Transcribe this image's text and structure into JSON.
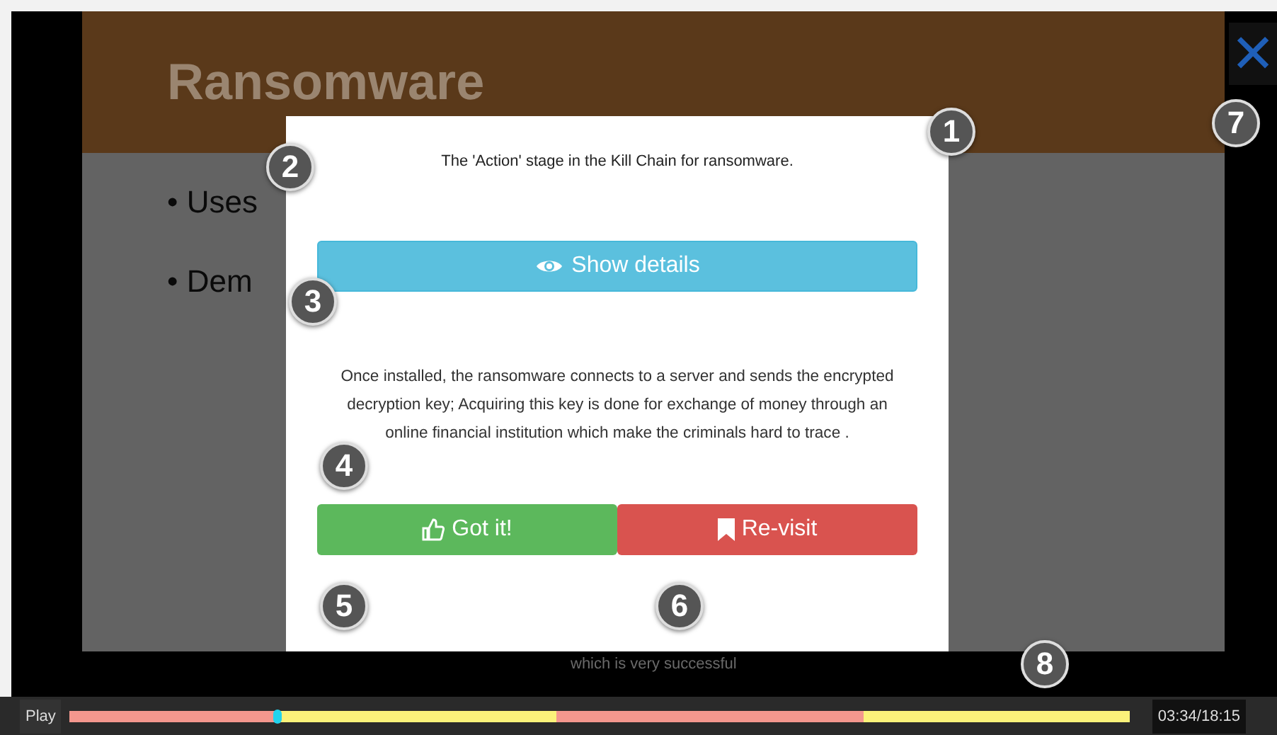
{
  "slide": {
    "title": "Ransomware",
    "bullets": [
      "• Uses",
      "• Dem"
    ],
    "caption": "which is very successful"
  },
  "modal": {
    "prompt": "The 'Action' stage in the Kill Chain for ransomware.",
    "details_button": "Show details",
    "description": "Once installed, the ransomware connects to a server and sends the encrypted decryption key; Acquiring this key is done for exchange of money through an online financial institution which make the criminals hard to trace .",
    "buttons": [
      {
        "kind": "got",
        "label": "Got it!"
      },
      {
        "kind": "revisit",
        "label": "Re-visit"
      }
    ]
  },
  "close": "✕",
  "player": {
    "play": "Play",
    "level": 0.196,
    "time": "03:34/18:15",
    "segments": [
      {
        "color": "#f4978e"
      },
      {
        "color": "#fbf27a"
      },
      {
        "color": "#f4978e"
      },
      {
        "color": "#fbf27a"
      }
    ]
  },
  "callouts": [
    "1",
    "2",
    "3",
    "4",
    "5",
    "6",
    "7",
    "8"
  ]
}
